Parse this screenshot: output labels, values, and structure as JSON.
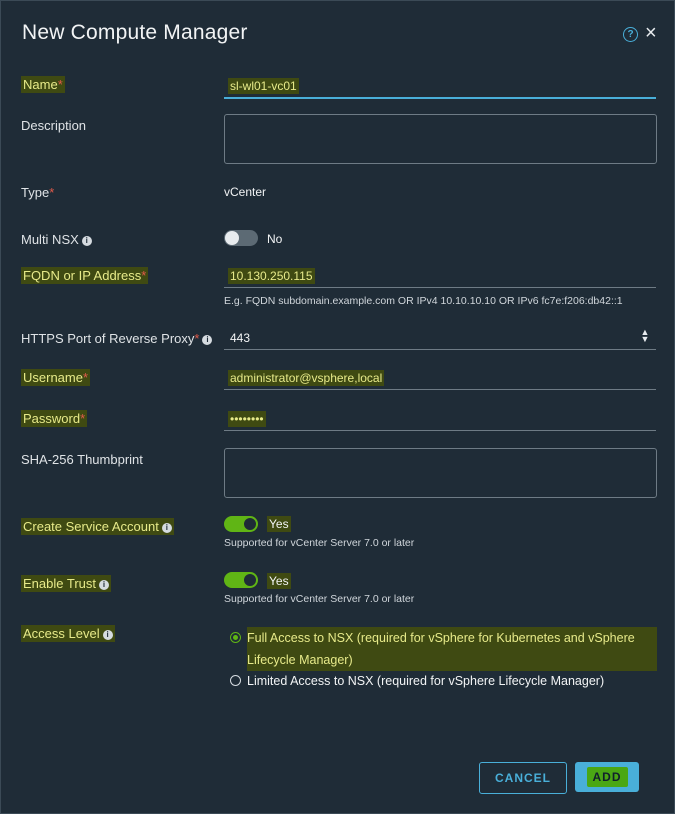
{
  "dialog": {
    "title": "New Compute Manager",
    "help_icon": "question-circle-icon",
    "close_icon": "close-icon"
  },
  "fields": {
    "name": {
      "label": "Name",
      "value": "sl-wl01-vc01"
    },
    "description": {
      "label": "Description",
      "value": ""
    },
    "type": {
      "label": "Type",
      "value": "vCenter"
    },
    "multi_nsx": {
      "label": "Multi NSX",
      "state": "No"
    },
    "fqdn": {
      "label": "FQDN or IP Address",
      "value": "10.130.250.115",
      "hint": "E.g. FQDN subdomain.example.com OR IPv4 10.10.10.10 OR IPv6 fc7e:f206:db42::1"
    },
    "https_port": {
      "label": "HTTPS Port of Reverse Proxy",
      "value": "443"
    },
    "username": {
      "label": "Username",
      "value": "administrator@vsphere,local"
    },
    "password": {
      "label": "Password",
      "value": "••••••••"
    },
    "thumbprint": {
      "label": "SHA-256 Thumbprint",
      "value": ""
    },
    "service_account": {
      "label": "Create Service Account",
      "state": "Yes",
      "hint": "Supported for vCenter Server 7.0 or later"
    },
    "enable_trust": {
      "label": "Enable Trust",
      "state": "Yes",
      "hint": "Supported for vCenter Server 7.0 or later"
    },
    "access_level": {
      "label": "Access Level",
      "options": [
        {
          "line1": "Full Access to NSX (required for vSphere for Kubernetes and vSphere",
          "line2": "Lifecycle Manager)",
          "selected": true
        },
        {
          "line1": "Limited Access to NSX (required for vSphere Lifecycle Manager)",
          "line2": "",
          "selected": false
        }
      ]
    }
  },
  "required_mark": "*",
  "buttons": {
    "cancel": "CANCEL",
    "add": "ADD"
  },
  "colors": {
    "accent": "#49afd9",
    "success": "#60b515",
    "required": "#e05a4a",
    "highlight": "#3f4a12"
  }
}
